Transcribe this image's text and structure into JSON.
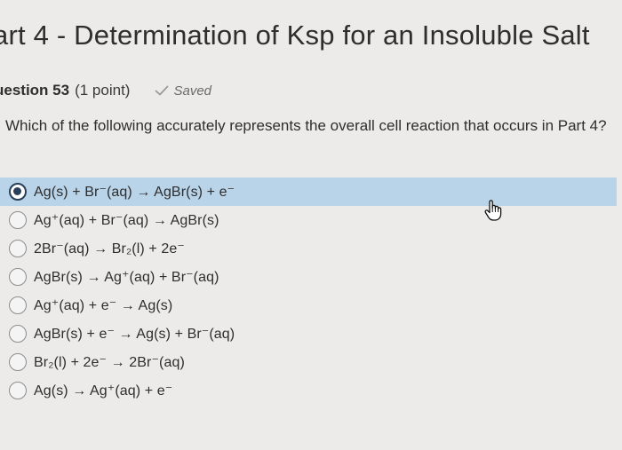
{
  "page": {
    "title": "art 4 - Determination of Ksp for an Insoluble Salt"
  },
  "question": {
    "label": "uestion 53",
    "points": "(1 point)",
    "status": "Saved",
    "text": "Which of the following accurately represents the overall cell reaction that occurs in Part 4?"
  },
  "options": [
    {
      "label": "Ag(s) + Br⁻(aq) → AgBr(s) + e⁻",
      "selected": true
    },
    {
      "label": "Ag⁺(aq) + Br⁻(aq) → AgBr(s)",
      "selected": false
    },
    {
      "label": "2Br⁻(aq) → Br₂(l) + 2e⁻",
      "selected": false
    },
    {
      "label": "AgBr(s) → Ag⁺(aq) + Br⁻(aq)",
      "selected": false
    },
    {
      "label": "Ag⁺(aq) + e⁻ → Ag(s)",
      "selected": false
    },
    {
      "label": "AgBr(s) + e⁻ → Ag(s) + Br⁻(aq)",
      "selected": false
    },
    {
      "label": "Br₂(l) + 2e⁻ → 2Br⁻(aq)",
      "selected": false
    },
    {
      "label": "Ag(s) → Ag⁺(aq) + e⁻",
      "selected": false
    }
  ],
  "colors": {
    "selected_row": "#b9d3e8",
    "radio_checked": "#2a3e5a",
    "background": "#ecebea"
  },
  "icons": {
    "saved": "check-icon",
    "cursor": "hand-pointer-icon"
  }
}
